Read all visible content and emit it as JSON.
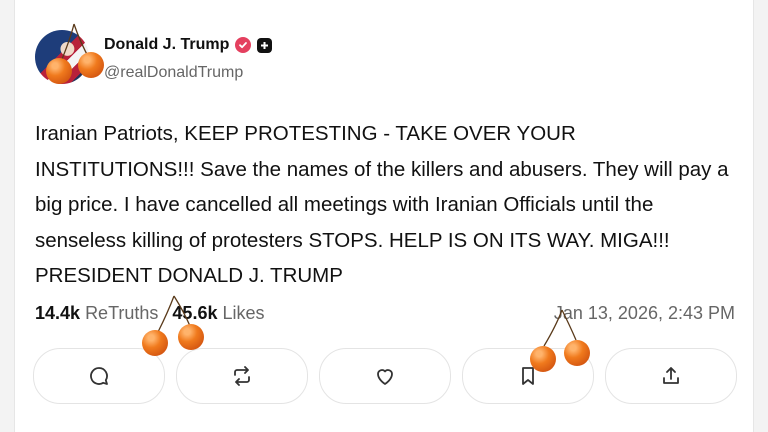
{
  "post": {
    "author_name": "Donald J. Trump",
    "author_handle": "@realDonaldTrump",
    "verified_icon": "verified-badge-icon",
    "plus_icon": "plus-badge-icon",
    "text": "Iranian Patriots, KEEP PROTESTING - TAKE OVER YOUR INSTITUTIONS!!! Save the names of the killers and abusers. They will pay a big price. I have cancelled all meetings with Iranian Officials until the senseless killing of protesters STOPS. HELP IS ON ITS WAY. MIGA!!! PRESIDENT DONALD J. TRUMP"
  },
  "stats": {
    "retruths_count": "14.4k",
    "retruths_label": "ReTruths",
    "likes_count": "45.6k",
    "likes_label": "Likes",
    "timestamp": "Jan 13, 2026, 2:43 PM"
  },
  "actions": [
    {
      "name": "reply",
      "icon": "comment-icon"
    },
    {
      "name": "retruth",
      "icon": "repost-icon"
    },
    {
      "name": "like",
      "icon": "heart-icon"
    },
    {
      "name": "bookmark",
      "icon": "bookmark-icon"
    },
    {
      "name": "share",
      "icon": "share-icon"
    }
  ],
  "colors": {
    "verified": "#e4405f",
    "muted_text": "#666666",
    "cherry": "#f07a1d"
  }
}
